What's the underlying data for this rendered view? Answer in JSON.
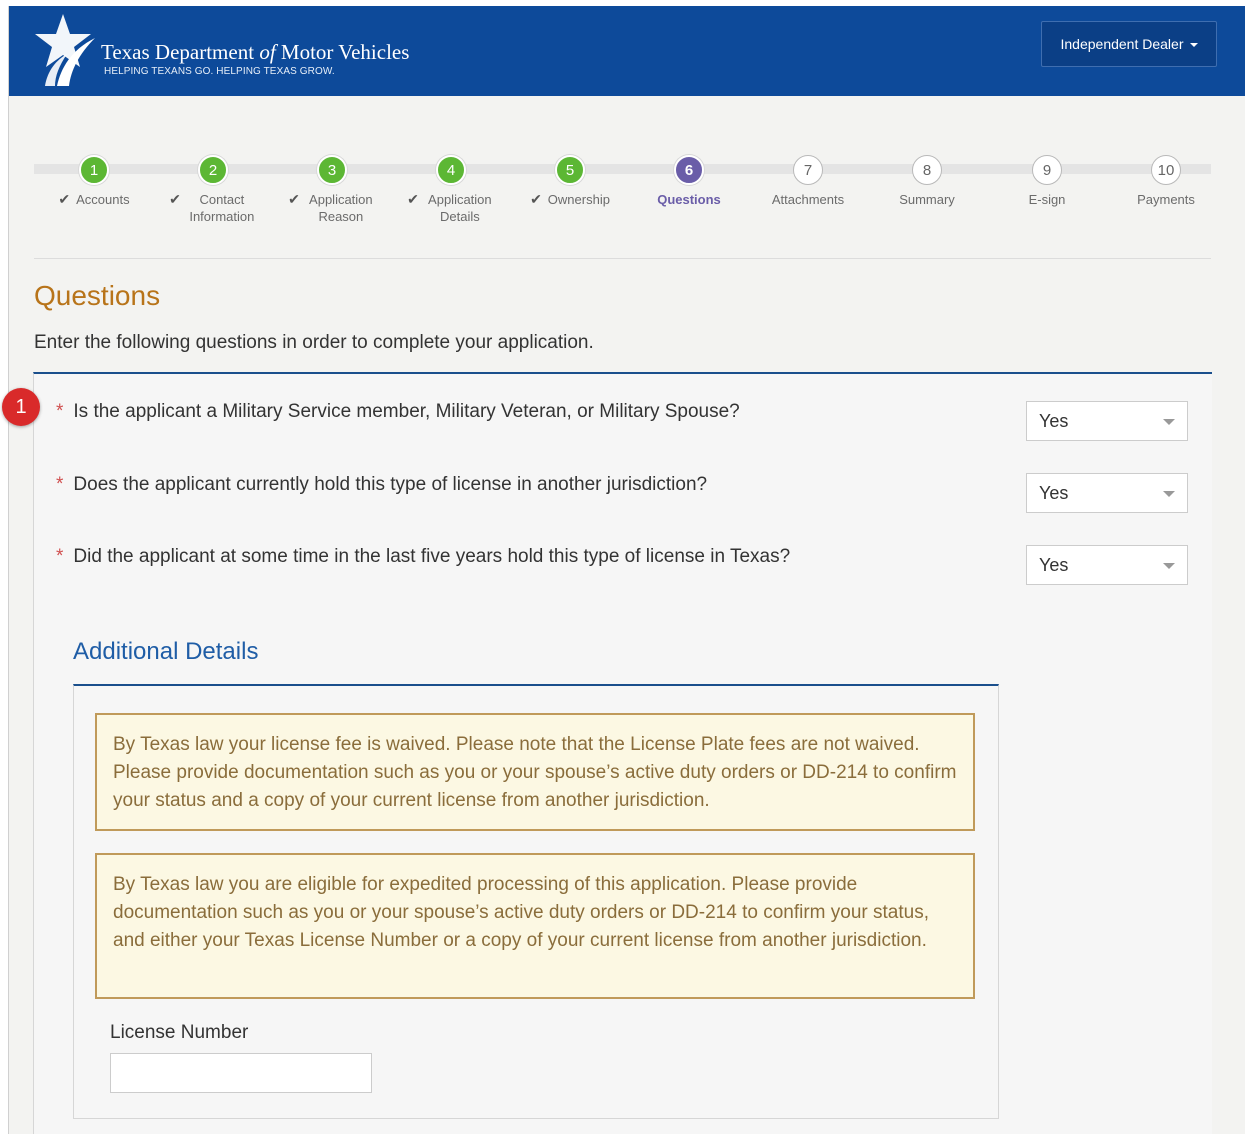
{
  "header": {
    "title_part1": "Texas Department ",
    "title_of": "of",
    "title_part2": " Motor Vehicles",
    "tagline": "HELPING TEXANS GO. HELPING TEXAS GROW.",
    "dealer_label": "Independent Dealer",
    "brand_color": "#0d4a9a"
  },
  "steps": [
    {
      "num": "1",
      "label": "Accounts",
      "status": "done"
    },
    {
      "num": "2",
      "label": "Contact Information",
      "status": "done"
    },
    {
      "num": "3",
      "label": "Application Reason",
      "status": "done"
    },
    {
      "num": "4",
      "label": "Application Details",
      "status": "done"
    },
    {
      "num": "5",
      "label": "Ownership",
      "status": "done"
    },
    {
      "num": "6",
      "label": "Questions",
      "status": "active"
    },
    {
      "num": "7",
      "label": "Attachments",
      "status": "todo"
    },
    {
      "num": "8",
      "label": "Summary",
      "status": "todo"
    },
    {
      "num": "9",
      "label": "E-sign",
      "status": "todo"
    },
    {
      "num": "10",
      "label": "Payments",
      "status": "todo"
    }
  ],
  "page": {
    "title": "Questions",
    "subtitle": "Enter the following questions in order to complete your application.",
    "badge": "1"
  },
  "questions": [
    {
      "required_mark": "*",
      "text": "Is the applicant a Military Service member, Military Veteran, or Military Spouse?",
      "answer": "Yes"
    },
    {
      "required_mark": "*",
      "text": "Does the applicant currently hold this type of license in another jurisdiction?",
      "answer": "Yes"
    },
    {
      "required_mark": "*",
      "text": "Did the applicant at some time in the last five years hold this type of license in Texas?",
      "answer": "Yes"
    }
  ],
  "additional_details": {
    "title": "Additional Details",
    "notices": [
      "By Texas law your license fee is waived. Please note that the License Plate fees are not waived. Please provide documentation such as you or your spouse’s active duty orders or DD-214 to confirm your status and a copy of your current license from another jurisdiction.",
      "By Texas law you are eligible for expedited processing of this application. Please provide documentation such as you or your spouse’s active duty orders or DD-214 to confirm your status, and either your Texas License Number or a copy of your current license from another jurisdiction."
    ],
    "license_number_label": "License Number",
    "license_number_value": ""
  },
  "colors": {
    "step_done": "#5cb734",
    "step_active": "#6a5da8",
    "title_orange": "#b8741a",
    "notice_bg": "#fcf8e3",
    "notice_border": "#c09a5a",
    "badge_red": "#d92a2a"
  },
  "icons": {
    "logo": "star-logo-icon",
    "check": "check-icon",
    "dropdown": "caret-down-icon"
  }
}
